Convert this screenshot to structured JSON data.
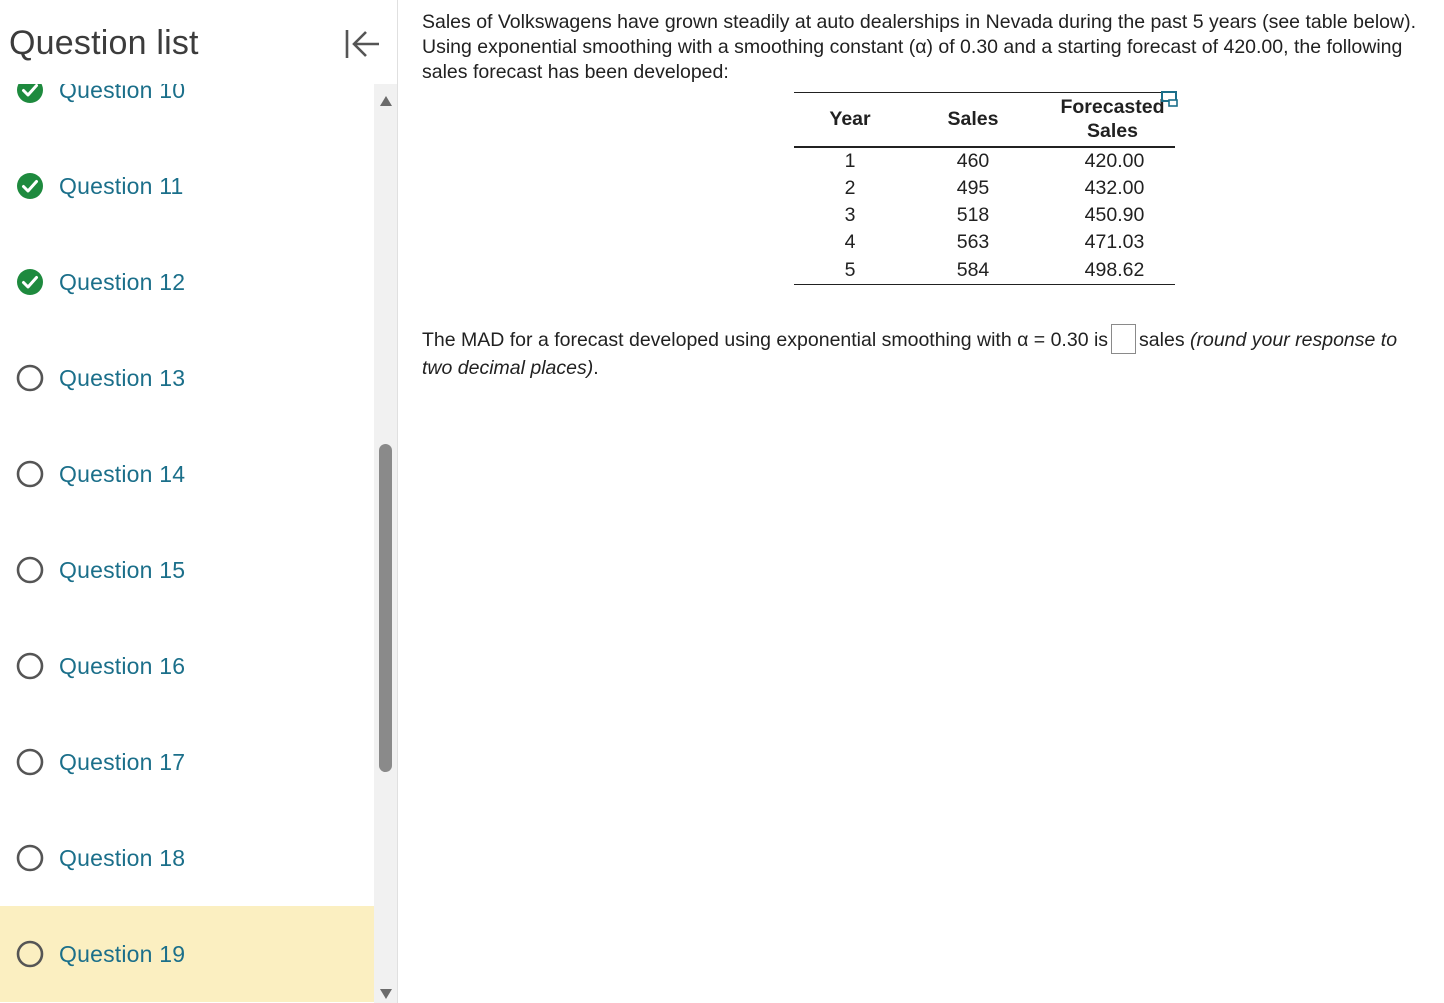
{
  "sidebar": {
    "title": "Question list",
    "items": [
      {
        "label": "Question 10",
        "status": "complete"
      },
      {
        "label": "Question 11",
        "status": "complete"
      },
      {
        "label": "Question 12",
        "status": "complete"
      },
      {
        "label": "Question 13",
        "status": "incomplete"
      },
      {
        "label": "Question 14",
        "status": "incomplete"
      },
      {
        "label": "Question 15",
        "status": "incomplete"
      },
      {
        "label": "Question 16",
        "status": "incomplete"
      },
      {
        "label": "Question 17",
        "status": "incomplete"
      },
      {
        "label": "Question 18",
        "status": "incomplete"
      },
      {
        "label": "Question 19",
        "status": "current"
      }
    ]
  },
  "question": {
    "intro": "Sales of Volkswagens have grown steadily at auto dealerships in Nevada during the past 5 years (see table below). Using exponential smoothing with a smoothing constant (α) of 0.30 and a starting forecast of 420.00, the following sales forecast has been developed:",
    "table": {
      "headers": [
        "Year",
        "Sales",
        "Forecasted Sales"
      ],
      "rows": [
        [
          "1",
          "460",
          "420.00"
        ],
        [
          "2",
          "495",
          "432.00"
        ],
        [
          "3",
          "518",
          "450.90"
        ],
        [
          "4",
          "563",
          "471.03"
        ],
        [
          "5",
          "584",
          "498.62"
        ]
      ]
    },
    "prompt_before": "The MAD for a forecast developed using exponential smoothing with α = 0.30 is",
    "prompt_after": "sales",
    "prompt_note": "(round your response to two decimal places)",
    "prompt_end": "."
  },
  "colors": {
    "complete": "#1e8a3e",
    "link": "#1b6f8a",
    "current_bg": "#fbefc1"
  }
}
